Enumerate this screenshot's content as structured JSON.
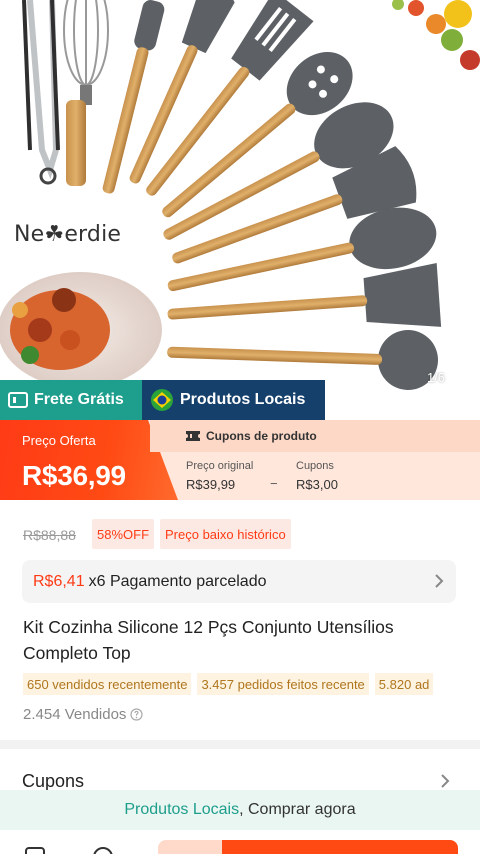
{
  "hero": {
    "brand": "Ne☘erdie",
    "image_counter": "1/6"
  },
  "badges": {
    "free_shipping": "Frete Grátis",
    "local_products": "Produtos Locais"
  },
  "price": {
    "offer_label": "Preço Oferta",
    "offer_price": "R$36,99",
    "coupon_header": "Cupons de produto",
    "original_label": "Preço original",
    "original_value": "R$39,99",
    "coupon_label": "Cupons",
    "coupon_value": "R$3,00",
    "minus_sign": "−"
  },
  "info": {
    "old_price": "R$88,88",
    "discount_tag": "58%OFF",
    "low_price_tag": "Preço baixo histórico",
    "installment_amount": "R$6,41",
    "installment_text": "x6 Pagamento parcelado",
    "title": "Kit Cozinha Silicone 12 Pçs Conjunto Utensílios Completo Top",
    "sales_tags": [
      "650 vendidos recentemente",
      "3.457 pedidos feitos recente",
      "5.820 ad"
    ],
    "sold_count": "2.454 Vendidos"
  },
  "coupons": {
    "label": "Cupons"
  },
  "cta": {
    "local_text": "Produtos Locais",
    "buy_text": ", Comprar agora"
  },
  "colors": {
    "accent_orange": "#ff4a14",
    "teal": "#1e9e8c",
    "navy": "#16406c",
    "gold_tag_text": "#b0761e"
  }
}
